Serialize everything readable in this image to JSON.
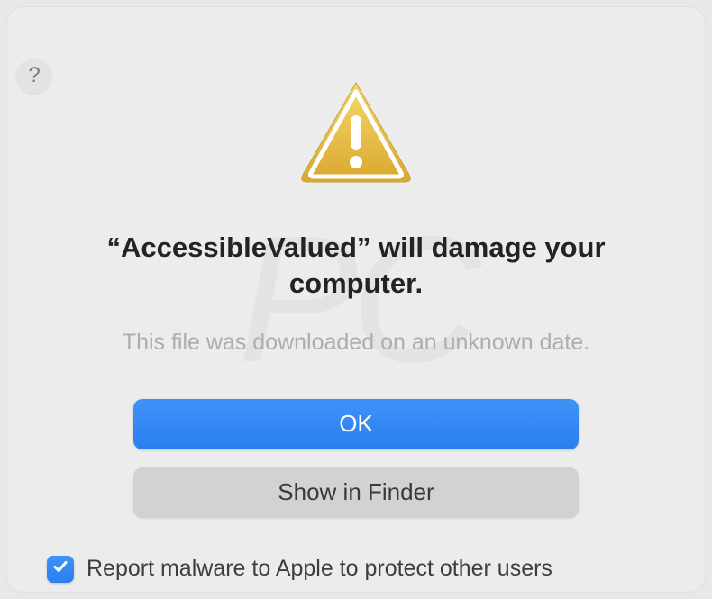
{
  "dialog": {
    "help_tooltip": "?",
    "app_name": "AccessibleValued",
    "message_prefix": "“",
    "message_suffix": "” will damage your computer.",
    "submessage": "This file was downloaded on an unknown date.",
    "buttons": {
      "ok": "OK",
      "show_in_finder": "Show in Finder"
    },
    "checkbox": {
      "checked": true,
      "label": "Report malware to Apple to protect other users"
    }
  },
  "icons": {
    "warning": "warning-triangle",
    "help": "question-mark",
    "check": "checkmark"
  }
}
